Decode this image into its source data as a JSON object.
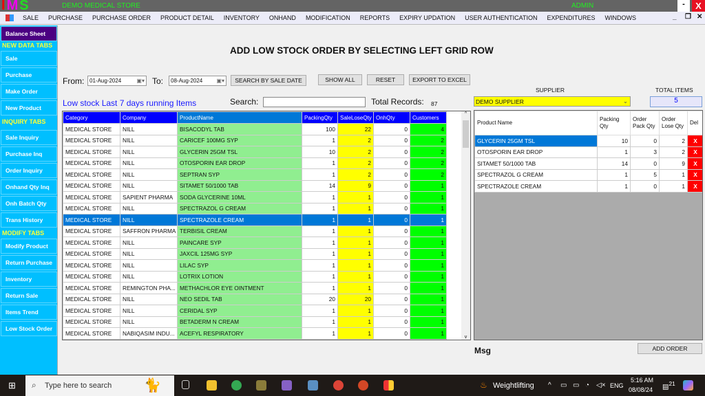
{
  "app": {
    "logo": "IMS",
    "store_name": "DEMO MEDICAL STORE",
    "user": "ADMIN",
    "minimize": "-",
    "close": "X"
  },
  "menu": [
    "SALE",
    "PURCHASE",
    "PURCHASE ORDER",
    "PRODUCT DETAIL",
    "INVENTORY",
    "ONHAND",
    "MODIFICATION",
    "REPORTS",
    "EXPIRY UPDATION",
    "USER AUTHENTICATION",
    "EXPENDITURES",
    "WINDOWS"
  ],
  "window_controls": {
    "min": "_",
    "restore": "❐",
    "close": "✕"
  },
  "sidebar": {
    "balance": "Balance Sheet",
    "new_header": "NEW DATA TABS",
    "new_items": [
      "Sale",
      "Purchase",
      "Make Order",
      "New Product"
    ],
    "inquiry_header": "INQUIRY TABS",
    "inquiry_items": [
      "Sale Inquiry",
      "Purchase Inq",
      "Order Inquiry",
      "Onhand Qty Inq",
      "Onh Batch Qty",
      "Trans History"
    ],
    "modify_header": "MODIFY TABS",
    "modify_items": [
      "Modify Product",
      "Return Purchase",
      "Inventory",
      "Return Sale",
      "Items Trend",
      "Low Stock Order"
    ]
  },
  "page": {
    "title": "ADD LOW STOCK ORDER BY SELECTING LEFT GRID ROW"
  },
  "filters": {
    "from_label": "From:",
    "from_value": "01-Aug-2024",
    "to_label": "To:",
    "to_value": "08-Aug-2024",
    "search_by_date": "SEARCH BY SALE DATE",
    "show_all": "SHOW ALL",
    "reset": "RESET",
    "export": "EXPORT TO EXCEL"
  },
  "left": {
    "caption": "Low stock Last 7 days running Items",
    "search_label": "Search:",
    "search_value": "",
    "total_label": "Total Records:",
    "total_value": "87",
    "columns": [
      "Category",
      "Company",
      "ProductName",
      "PackingQty",
      "SaleLoseQty",
      "OnhQty",
      "Customers"
    ],
    "selected_index": 8,
    "rows": [
      [
        "MEDICAL STORE",
        "NILL",
        "BISACODYL TAB",
        100,
        22,
        0,
        4
      ],
      [
        "MEDICAL STORE",
        "NILL",
        "CARICEF 100MG SYP",
        1,
        2,
        0,
        2
      ],
      [
        "MEDICAL STORE",
        "NILL",
        "GLYCERIN 25GM TSL",
        10,
        2,
        0,
        2
      ],
      [
        "MEDICAL STORE",
        "NILL",
        "OTOSPORIN EAR DROP",
        1,
        2,
        0,
        2
      ],
      [
        "MEDICAL STORE",
        "NILL",
        "SEPTRAN SYP",
        1,
        2,
        0,
        2
      ],
      [
        "MEDICAL STORE",
        "NILL",
        "SITAMET 50/1000 TAB",
        14,
        9,
        0,
        1
      ],
      [
        "MEDICAL STORE",
        "SAPIENT PHARMA",
        "SODA GLYCERINE 10ML",
        1,
        1,
        0,
        1
      ],
      [
        "MEDICAL STORE",
        "NILL",
        "SPECTRAZOL G CREAM",
        1,
        1,
        0,
        1
      ],
      [
        "MEDICAL STORE",
        "NILL",
        "SPECTRAZOLE CREAM",
        1,
        1,
        0,
        1
      ],
      [
        "MEDICAL STORE",
        "SAFFRON PHARMA",
        "TERBISIL CREAM",
        1,
        1,
        0,
        1
      ],
      [
        "MEDICAL STORE",
        "NILL",
        "PAINCARE SYP",
        1,
        1,
        0,
        1
      ],
      [
        "MEDICAL STORE",
        "NILL",
        "JAXCIL 125MG SYP",
        1,
        1,
        0,
        1
      ],
      [
        "MEDICAL STORE",
        "NILL",
        "LILAC SYP",
        1,
        1,
        0,
        1
      ],
      [
        "MEDICAL STORE",
        "NILL",
        "LOTRIX LOTION",
        1,
        1,
        0,
        1
      ],
      [
        "MEDICAL STORE",
        "REMINGTON PHA...",
        "METHACHLOR EYE OINTMENT",
        1,
        1,
        0,
        1
      ],
      [
        "MEDICAL STORE",
        "NILL",
        "NEO SEDIL TAB",
        20,
        20,
        0,
        1
      ],
      [
        "MEDICAL STORE",
        "NILL",
        "CERIDAL SYP",
        1,
        1,
        0,
        1
      ],
      [
        "MEDICAL STORE",
        "NILL",
        "BETADERM N CREAM",
        1,
        1,
        0,
        1
      ],
      [
        "MEDICAL STORE",
        "NABIQASIM INDU...",
        "ACEFYL RESPIRATORY",
        1,
        1,
        0,
        1
      ]
    ]
  },
  "right": {
    "supplier_label": "SUPPLIER",
    "supplier_value": "DEMO SUPPLIER",
    "total_items_label": "TOTAL ITEMS",
    "total_items_value": "5",
    "columns": [
      "Product Name",
      "Packing Qty",
      "Order Pack Qty",
      "Order Lose Qty",
      "Del"
    ],
    "selected_index": 0,
    "rows": [
      [
        "GLYCERIN 25GM TSL",
        10,
        0,
        2,
        "X"
      ],
      [
        "OTOSPORIN EAR DROP",
        1,
        3,
        2,
        "X"
      ],
      [
        "SITAMET 50/1000 TAB",
        14,
        0,
        9,
        "X"
      ],
      [
        "SPECTRAZOL G CREAM",
        1,
        5,
        1,
        "X"
      ],
      [
        "SPECTRAZOLE CREAM",
        1,
        0,
        1,
        "X"
      ]
    ],
    "msg_label": "Msg",
    "add_order": "ADD ORDER"
  },
  "taskbar": {
    "search_placeholder": "Type here to search",
    "weather": "Weightlifting",
    "lang": "ENG",
    "time": "5:16 AM",
    "date": "08/08/24",
    "notifications": "21"
  },
  "colors": {
    "header_blue": "#0000ff",
    "selection": "#0078d7",
    "sidebar": "#00bfff",
    "yellow": "#ffff00",
    "green": "#00ff00",
    "light_green": "#90ee90",
    "delete_red": "#ff0000"
  }
}
